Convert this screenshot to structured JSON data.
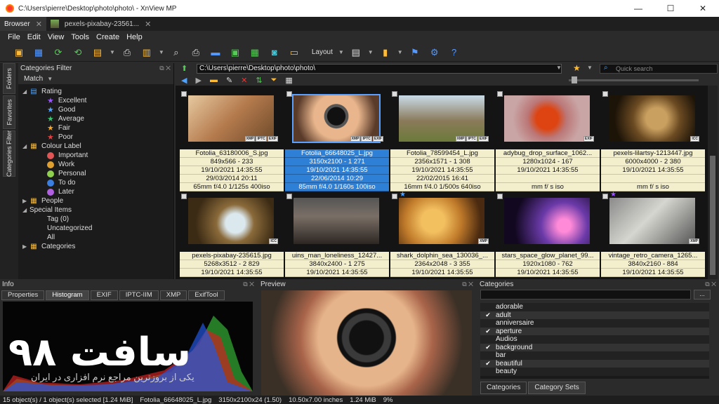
{
  "window": {
    "title": "C:\\Users\\pierre\\Desktop\\photo\\photo\\ - XnView MP",
    "min": "—",
    "max": "☐",
    "close": "✕"
  },
  "tabs": [
    {
      "label": "Browser"
    },
    {
      "label": "pexels-pixabay-23561..."
    }
  ],
  "menu": [
    "File",
    "Edit",
    "View",
    "Tools",
    "Create",
    "Help"
  ],
  "toolbar": {
    "layout_label": "Layout"
  },
  "sidetabs": [
    "Folders",
    "Favorites",
    "Categories Filter"
  ],
  "categories_filter": {
    "title": "Categories Filter",
    "match_label": "Match",
    "rating": {
      "label": "Rating",
      "items": [
        {
          "label": "Excellent",
          "color": "#9b59ff"
        },
        {
          "label": "Good",
          "color": "#4da3ff"
        },
        {
          "label": "Average",
          "color": "#3cc36b"
        },
        {
          "label": "Fair",
          "color": "#f5a623"
        },
        {
          "label": "Poor",
          "color": "#e04040"
        }
      ]
    },
    "colour": {
      "label": "Colour Label",
      "items": [
        {
          "label": "Important",
          "color": "#e05555"
        },
        {
          "label": "Work",
          "color": "#e0a030"
        },
        {
          "label": "Personal",
          "color": "#8fd14f"
        },
        {
          "label": "To do",
          "color": "#3a7fe0"
        },
        {
          "label": "Later",
          "color": "#b060e0"
        }
      ]
    },
    "people": "People",
    "special": {
      "label": "Special Items",
      "items": [
        "Tag (0)",
        "Uncategorized",
        "All"
      ]
    },
    "categories": "Categories"
  },
  "path": "C:\\Users\\pierre\\Desktop\\photo\\photo\\",
  "quick_search_placeholder": "Quick search",
  "thumbnails": [
    {
      "name": "Fotolia_63180006_S.jpg",
      "dim": "849x566 - 233",
      "date": "19/10/2021 14:35:55",
      "date2": "29/03/2014 20:11",
      "exif": "65mm f/4.0 1/125s 400iso",
      "badges": [
        "XMP",
        "IPTC",
        "EXIF"
      ],
      "bg": "linear-gradient(135deg,#e7c9a0,#b47a4d 50%,#6d4a2a)"
    },
    {
      "name": "Fotolia_66648025_L.jpg",
      "dim": "3150x2100 - 1 271",
      "date": "19/10/2021 14:35:55",
      "date2": "22/06/2014 10:29",
      "exif": "85mm f/4.0 1/160s 100iso",
      "badges": [
        "XMP",
        "IPTC",
        "EXIF"
      ],
      "bg": "radial-gradient(circle at 50% 45%,#111 0 18%,#555 19% 24%,#e8b58c 25% 45%,#5a3b2a 80%)",
      "selected": true
    },
    {
      "name": "Fotolia_78599454_L.jpg",
      "dim": "2356x1571 - 1 308",
      "date": "19/10/2021 14:35:55",
      "date2": "22/02/2015 16:41",
      "exif": "16mm f/4.0 1/500s 640iso",
      "badges": [
        "XMP",
        "IPTC",
        "EXIF"
      ],
      "bg": "linear-gradient(180deg,#c9dbe8,#8a7a5a 55%,#6c7a3a)"
    },
    {
      "name": "adybug_drop_surface_1062...",
      "dim": "1280x1024 - 167",
      "date": "19/10/2021 14:35:55",
      "date2": "",
      "exif": "mm f/ s iso",
      "badges": [
        "EXIF"
      ],
      "bg": "radial-gradient(circle at 50% 50%,#d41 0 22%,#b77 40%,#c9a5a5 70%)"
    },
    {
      "name": "pexels-lilartsy-1213447.jpg",
      "dim": "6000x4000 - 2 380",
      "date": "19/10/2021 14:35:55",
      "date2": "",
      "exif": "mm f/ s iso",
      "badges": [
        "ICC"
      ],
      "bg": "radial-gradient(circle at 55% 50%,#caa060 0 20%,#6b4a22 45%,#1d1408 80%)"
    },
    {
      "name": "pexels-pixabay-235615.jpg",
      "dim": "5268x3512 - 2 829",
      "date": "19/10/2021 14:35:55",
      "date2": "",
      "exif": "",
      "badges": [
        "ICC"
      ],
      "bg": "radial-gradient(circle at 55% 55%,#dbe8ee 0 18%,#8a6a3a 35%,#3b2a14 75%)"
    },
    {
      "name": "uins_man_loneliness_12427...",
      "dim": "3840x2400 - 1 275",
      "date": "19/10/2021 14:35:55",
      "date2": "",
      "exif": "",
      "badges": [],
      "bg": "linear-gradient(180deg,#555,#7a6f66 40%,#2c2622)"
    },
    {
      "name": "shark_dolphin_sea_130036_...",
      "dim": "2364x2048 - 3 355",
      "date": "19/10/2021 14:35:55",
      "date2": "",
      "exif": "",
      "badges": [
        "XMP"
      ],
      "bg": "radial-gradient(circle at 40% 50%,#f3c060 0 20%,#c07a2a 50%,#4a2a10 85%)",
      "star": "#4da3ff"
    },
    {
      "name": "stars_space_glow_planet_99...",
      "dim": "1920x1080 - 762",
      "date": "19/10/2021 14:35:55",
      "date2": "",
      "exif": "",
      "badges": [],
      "bg": "radial-gradient(circle at 70% 60%,#ff8ad8 0 10%,#6a3aa8 35%,#120820 75%)"
    },
    {
      "name": "vintage_retro_camera_1265...",
      "dim": "3840x2160 - 884",
      "date": "19/10/2021 14:35:55",
      "date2": "",
      "exif": "",
      "badges": [
        "XMP"
      ],
      "bg": "linear-gradient(135deg,#8a8a8a,#d6d6d0 45%,#555)",
      "star": "#9b59ff"
    }
  ],
  "info": {
    "title": "Info",
    "tabs": [
      "Properties",
      "Histogram",
      "EXIF",
      "IPTC-IIM",
      "XMP",
      "ExifTool"
    ],
    "watermark": "سافت ۹۸",
    "watermark_sub": "یکی از بروزترین مراجع نرم افزاری در ایران"
  },
  "preview": {
    "title": "Preview"
  },
  "categories_panel": {
    "title": "Categories",
    "button": "...",
    "items": [
      {
        "label": "adorable",
        "checked": false
      },
      {
        "label": "adult",
        "checked": true
      },
      {
        "label": "anniversaire",
        "checked": false
      },
      {
        "label": "aperture",
        "checked": true
      },
      {
        "label": "Audios",
        "checked": false
      },
      {
        "label": "background",
        "checked": true
      },
      {
        "label": "bar",
        "checked": false
      },
      {
        "label": "beautiful",
        "checked": true
      },
      {
        "label": "beauty",
        "checked": false
      }
    ],
    "tabs": [
      "Categories",
      "Category Sets"
    ]
  },
  "status": [
    "15 object(s) / 1 object(s) selected [1.24 MiB]",
    "Fotolia_66648025_L.jpg",
    "3150x2100x24 (1.50)",
    "10.50x7.00 inches",
    "1.24 MiB",
    "9%"
  ]
}
